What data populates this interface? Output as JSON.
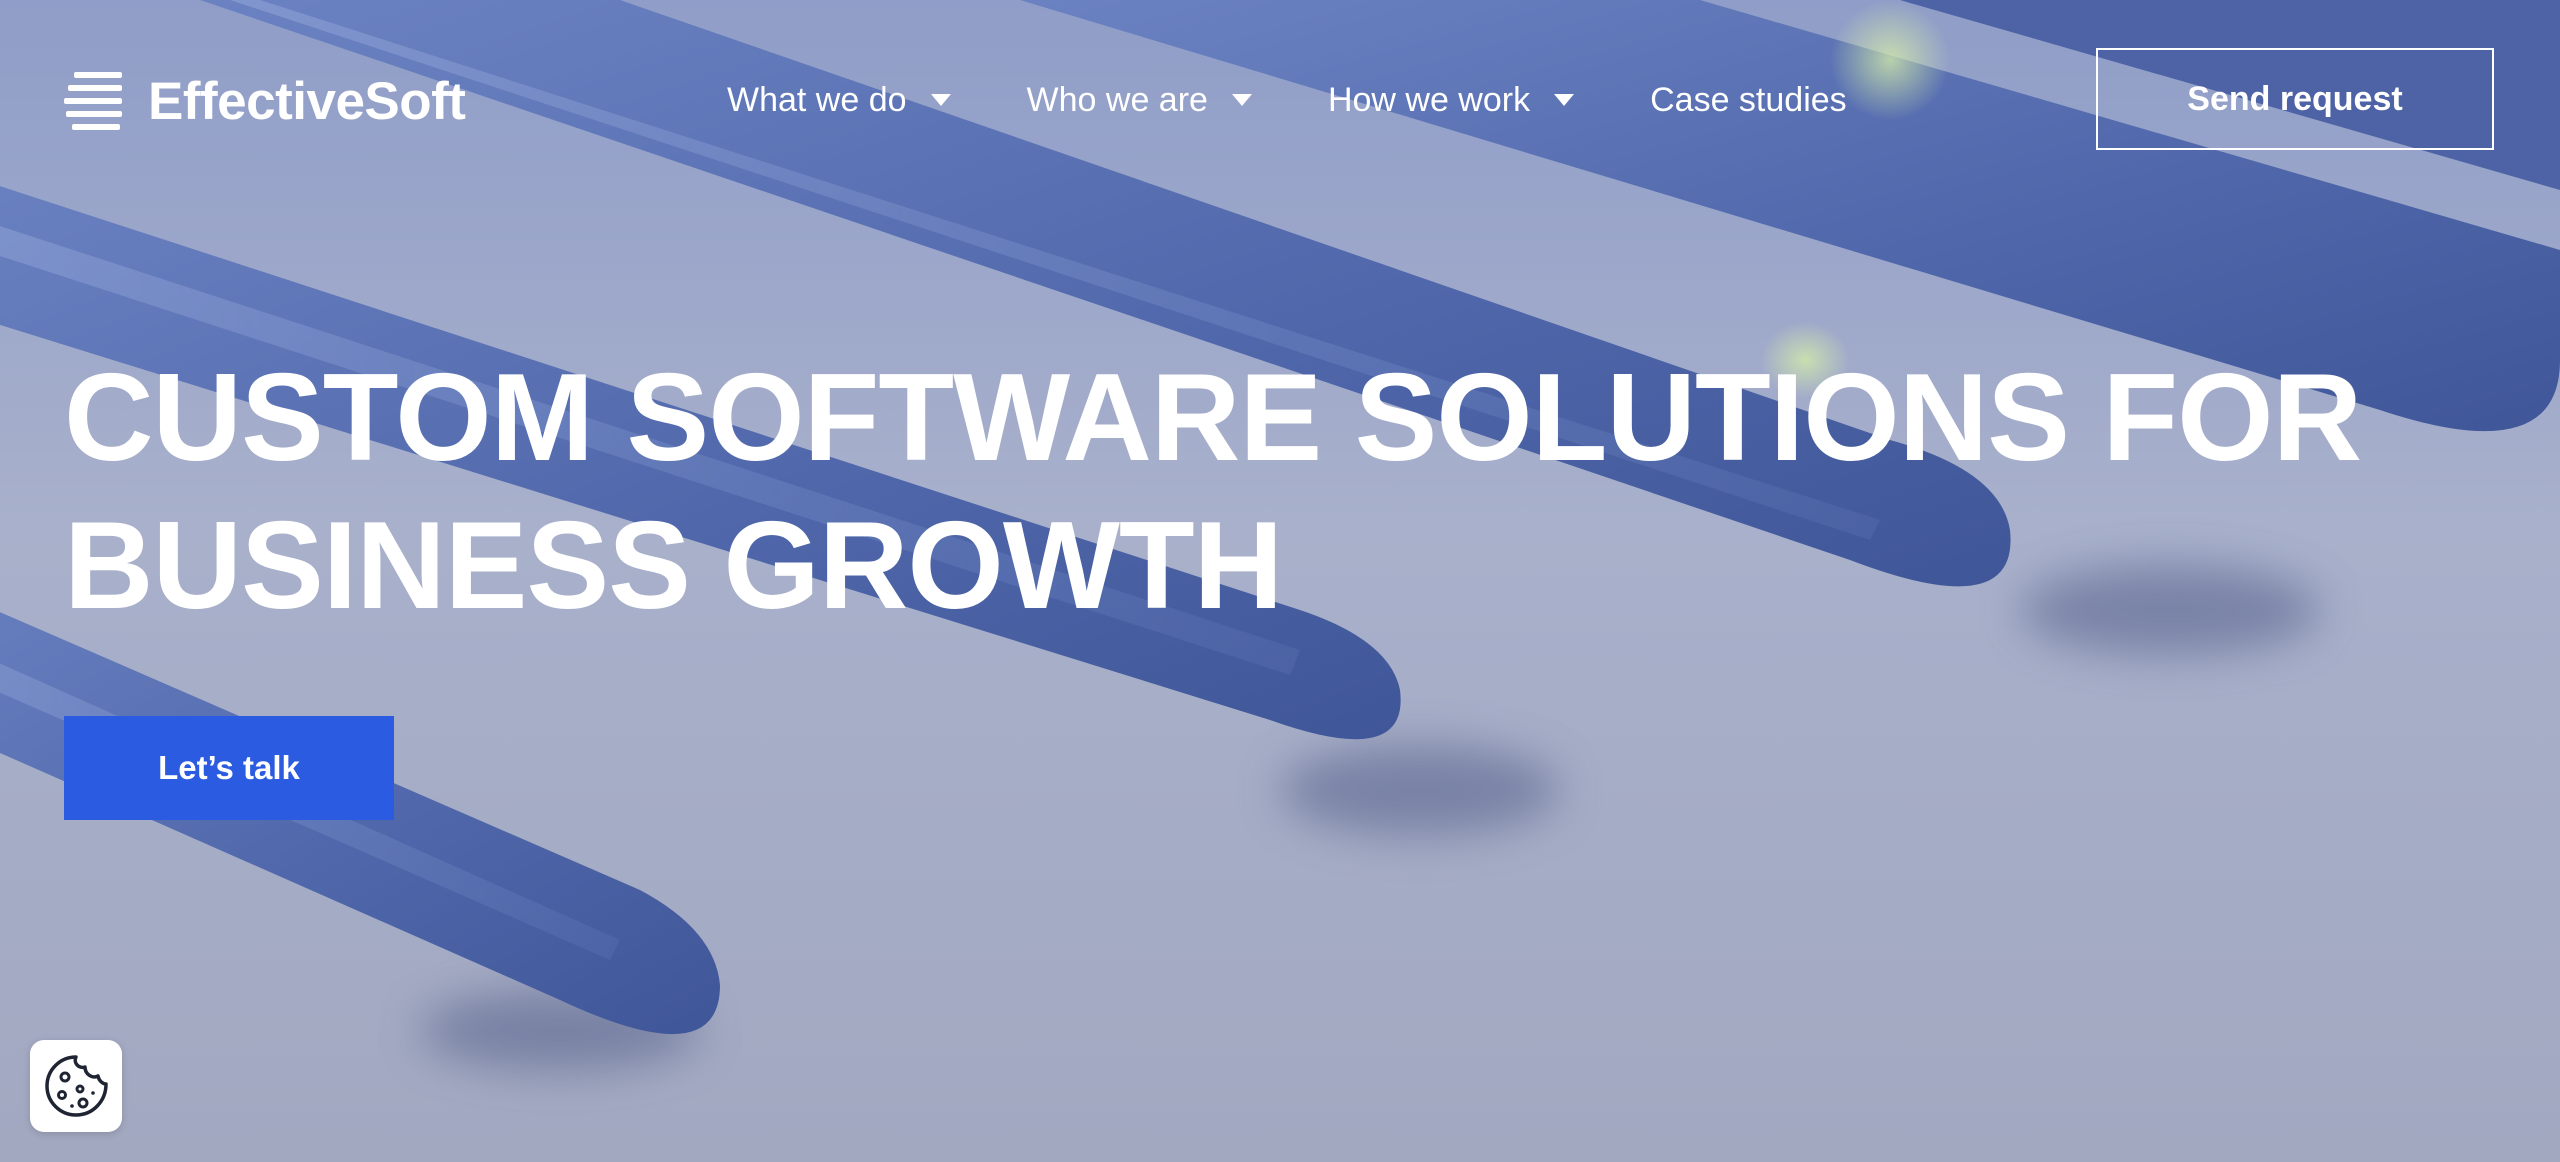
{
  "brand": {
    "name": "EffectiveSoft",
    "logo_icon": "stacked-lines-logo-icon"
  },
  "nav": {
    "items": [
      {
        "label": "What we do",
        "has_dropdown": true
      },
      {
        "label": "Who we are",
        "has_dropdown": true
      },
      {
        "label": "How we work",
        "has_dropdown": true
      },
      {
        "label": "Case studies",
        "has_dropdown": false
      }
    ],
    "send_request_label": "Send request"
  },
  "hero": {
    "headline_line1": "CUSTOM SOFTWARE SOLUTIONS FOR",
    "headline_line2": "BUSINESS GROWTH",
    "cta_label": "Let’s talk"
  },
  "cookie_button": {
    "icon": "cookie-icon"
  },
  "colors": {
    "accent": "#2a5be0",
    "text_on_hero": "#ffffff",
    "hero_surface": "#a3abc6",
    "hero_bars": "#5a72b2"
  }
}
